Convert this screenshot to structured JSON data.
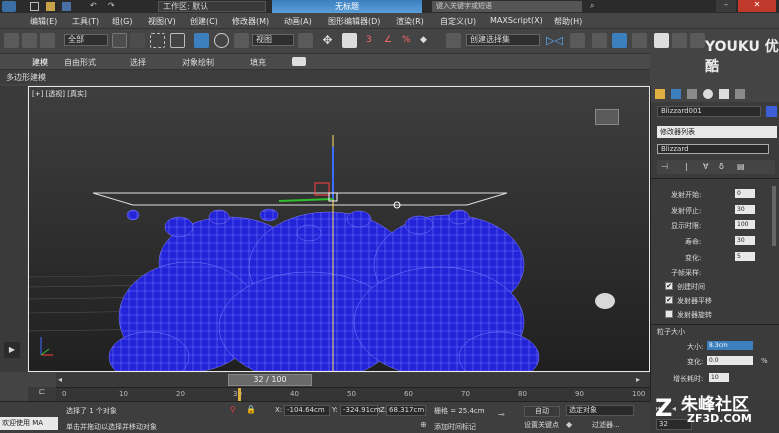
{
  "titlebar": {
    "workspace": "工作区: 默认",
    "document": "无标题",
    "search_placeholder": "键入关键字或短语"
  },
  "menu": [
    "编辑(E)",
    "工具(T)",
    "组(G)",
    "视图(V)",
    "创建(C)",
    "修改器(M)",
    "动画(A)",
    "图形编辑器(D)",
    "渲染(R)",
    "自定义(U)",
    "MAXScript(X)",
    "帮助(H)"
  ],
  "toolbar": {
    "selection_filter": "全部",
    "ref_coord": "视图",
    "named_selection": "创建选择集"
  },
  "ribbon": {
    "tabs": [
      "建模",
      "自由形式",
      "选择",
      "对象绘制",
      "填充"
    ],
    "sub": "多边形建模"
  },
  "viewport": {
    "label": "[+] [透视] [真实]"
  },
  "command_panel": {
    "object_name": "Blizzard001",
    "modifier_list": "修改器列表",
    "stack_item": "Blizzard",
    "params": [
      {
        "label": "发射开始:",
        "value": "0"
      },
      {
        "label": "发射停止:",
        "value": "30"
      },
      {
        "label": "显示时限:",
        "value": "100"
      },
      {
        "label": "寿命:",
        "value": "30"
      },
      {
        "label": "变化:",
        "value": "5"
      }
    ],
    "subframe_title": "子帧采样:",
    "checks": [
      {
        "label": "创建时间",
        "checked": true
      },
      {
        "label": "发射器平移",
        "checked": true
      },
      {
        "label": "发射器旋转",
        "checked": false
      }
    ],
    "size_title": "粒子大小",
    "size_params": [
      {
        "label": "大小:",
        "value": "8.3cm"
      },
      {
        "label": "变化:",
        "value": "0.0",
        "unit": "%"
      },
      {
        "label": "增长耗时:",
        "value": "10"
      }
    ]
  },
  "timeline": {
    "frame": "32 / 100",
    "ticks": [
      "0",
      "10",
      "20",
      "30",
      "40",
      "50",
      "60",
      "70",
      "80",
      "90",
      "100"
    ]
  },
  "status": {
    "script_label": "欢迎使用 MA",
    "selection": "选择了 1 个对象",
    "prompt": "单击并拖动以选择并移动对象",
    "x_label": "X:",
    "x": "-104.64cm",
    "y_label": "Y:",
    "y": "-324.91cm",
    "z_label": "Z:",
    "z": "68.317cm",
    "grid": "栅格 = 25.4cm",
    "add_time_tag": "添加时间标记",
    "auto_key": "自动",
    "set_key": "设置关键点",
    "key_filter": "选定对象",
    "filters": "过滤器...",
    "current_frame": "32"
  },
  "watermarks": {
    "youku": "YOUKU 优酷",
    "zhufeng": "朱峰社区",
    "zf3d": "ZF3D.COM"
  },
  "colors": {
    "teapot_blue": "#2323d8",
    "accent": "#3c7fbf"
  }
}
